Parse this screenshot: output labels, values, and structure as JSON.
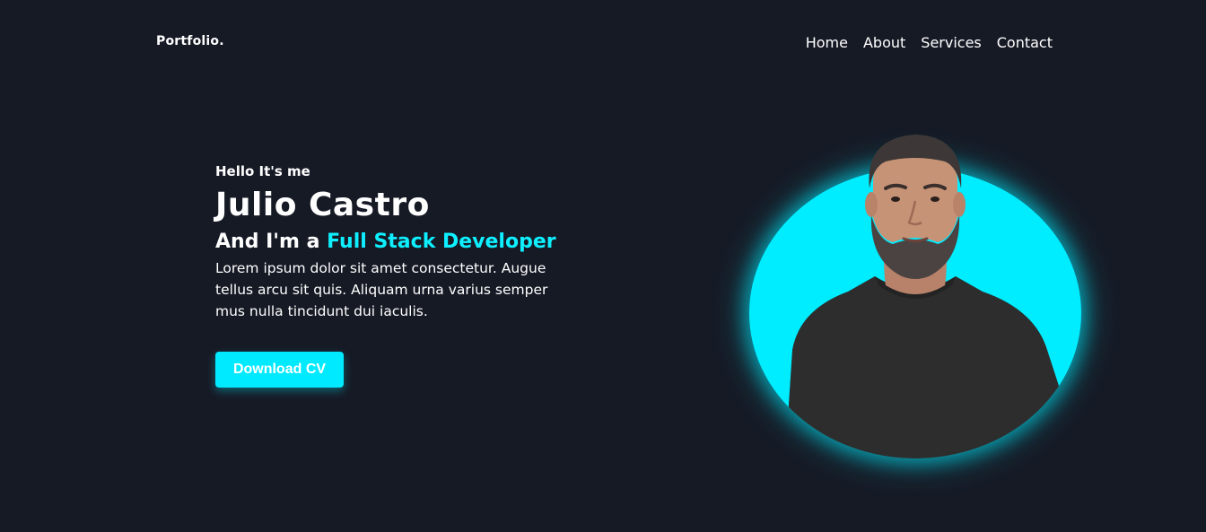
{
  "header": {
    "logo": "Portfolio.",
    "nav": [
      "Home",
      "About",
      "Services",
      "Contact"
    ]
  },
  "hero": {
    "greeting": "Hello It's me",
    "name": "Julio Castro",
    "role_prefix": "And I'm a ",
    "role_highlight": "Full Stack Developer",
    "description": "Lorem ipsum dolor sit amet consectetur. Augue tellus arcu sit quis. Aliquam urna varius semper mus nulla tincidunt dui iaculis.",
    "cta_label": "Download CV"
  },
  "colors": {
    "background": "#161a25",
    "accent": "#00eaff",
    "text": "#ffffff"
  }
}
